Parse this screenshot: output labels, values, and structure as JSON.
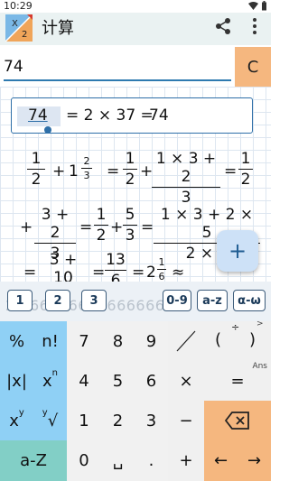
{
  "status_bar": {
    "time": "10:29"
  },
  "app_bar": {
    "title": "计算"
  },
  "input": {
    "value": "74"
  },
  "clear_label": "C",
  "result": {
    "input_value": "74",
    "equation": "= 2 × 37 =",
    "output_value": "74"
  },
  "steps": {
    "line1": {
      "f1_num": "1",
      "f1_den": "2",
      "plus": "+",
      "mixed_whole": "1",
      "mixed_num": "2",
      "mixed_den": "3",
      "eq1": "=",
      "f2_num": "1",
      "f2_den": "2",
      "plus2": "+",
      "f3_num": "1 × 3 + 2",
      "f3_den": "3",
      "eq2": "=",
      "f4_num": "1",
      "f4_den": "2"
    },
    "line2": {
      "plus": "+",
      "f1_num": "3 + 2",
      "f1_den": "3",
      "eq1": "=",
      "f2_num": "1",
      "f2_den": "2",
      "plus2": "+",
      "f3_num": "5",
      "f3_den": "3",
      "eq2": "=",
      "f4_num": "1 × 3 + 2 × 5",
      "f4_den": "2 × 3"
    },
    "line3": {
      "eq1": "=",
      "f1_num": "3 + 10",
      "f1_den": "6",
      "eq2": "=",
      "f2_num": "13",
      "f2_den": "6",
      "eq3": "=",
      "mixed_whole": "2",
      "mixed_num": "1",
      "mixed_den": "6",
      "approx": "≈"
    }
  },
  "fab_label": "+",
  "suggestions": {
    "buttons": [
      "1",
      "2",
      "3",
      "0-9",
      "a-z",
      "α-ω"
    ],
    "ghost_text": "2.1666666666666667"
  },
  "keyboard": {
    "percent": "%",
    "factorial": "n!",
    "abs": "|x|",
    "power_base": "x",
    "power_exp": "n",
    "xy_x": "x",
    "xy_y": "y",
    "root_y": "y",
    "root": "√",
    "az": "a-Z",
    "digits": [
      "7",
      "8",
      "9",
      "4",
      "5",
      "6",
      "1",
      "2",
      "3",
      "0"
    ],
    "space": "␣",
    "dot": ".",
    "divide": "÷",
    "open_paren": "(",
    "close_paren": ")",
    "less": "<",
    "greater": ">",
    "multiply": "×",
    "equals": "=",
    "ans": "Ans",
    "minus": "−",
    "plus": "+",
    "left": "←",
    "right": "→",
    "backspace": "⌫"
  },
  "colors": {
    "accent_blue": "#2e6fa8",
    "key_blue": "#8fd0f5",
    "key_orange": "#f5b77f",
    "key_teal": "#82cfc6",
    "appbar_bg": "#eaf2f2"
  },
  "icons": [
    "app-logo-icon",
    "share-icon",
    "more-vert-icon",
    "wifi-icon",
    "battery-icon",
    "backspace-icon"
  ]
}
